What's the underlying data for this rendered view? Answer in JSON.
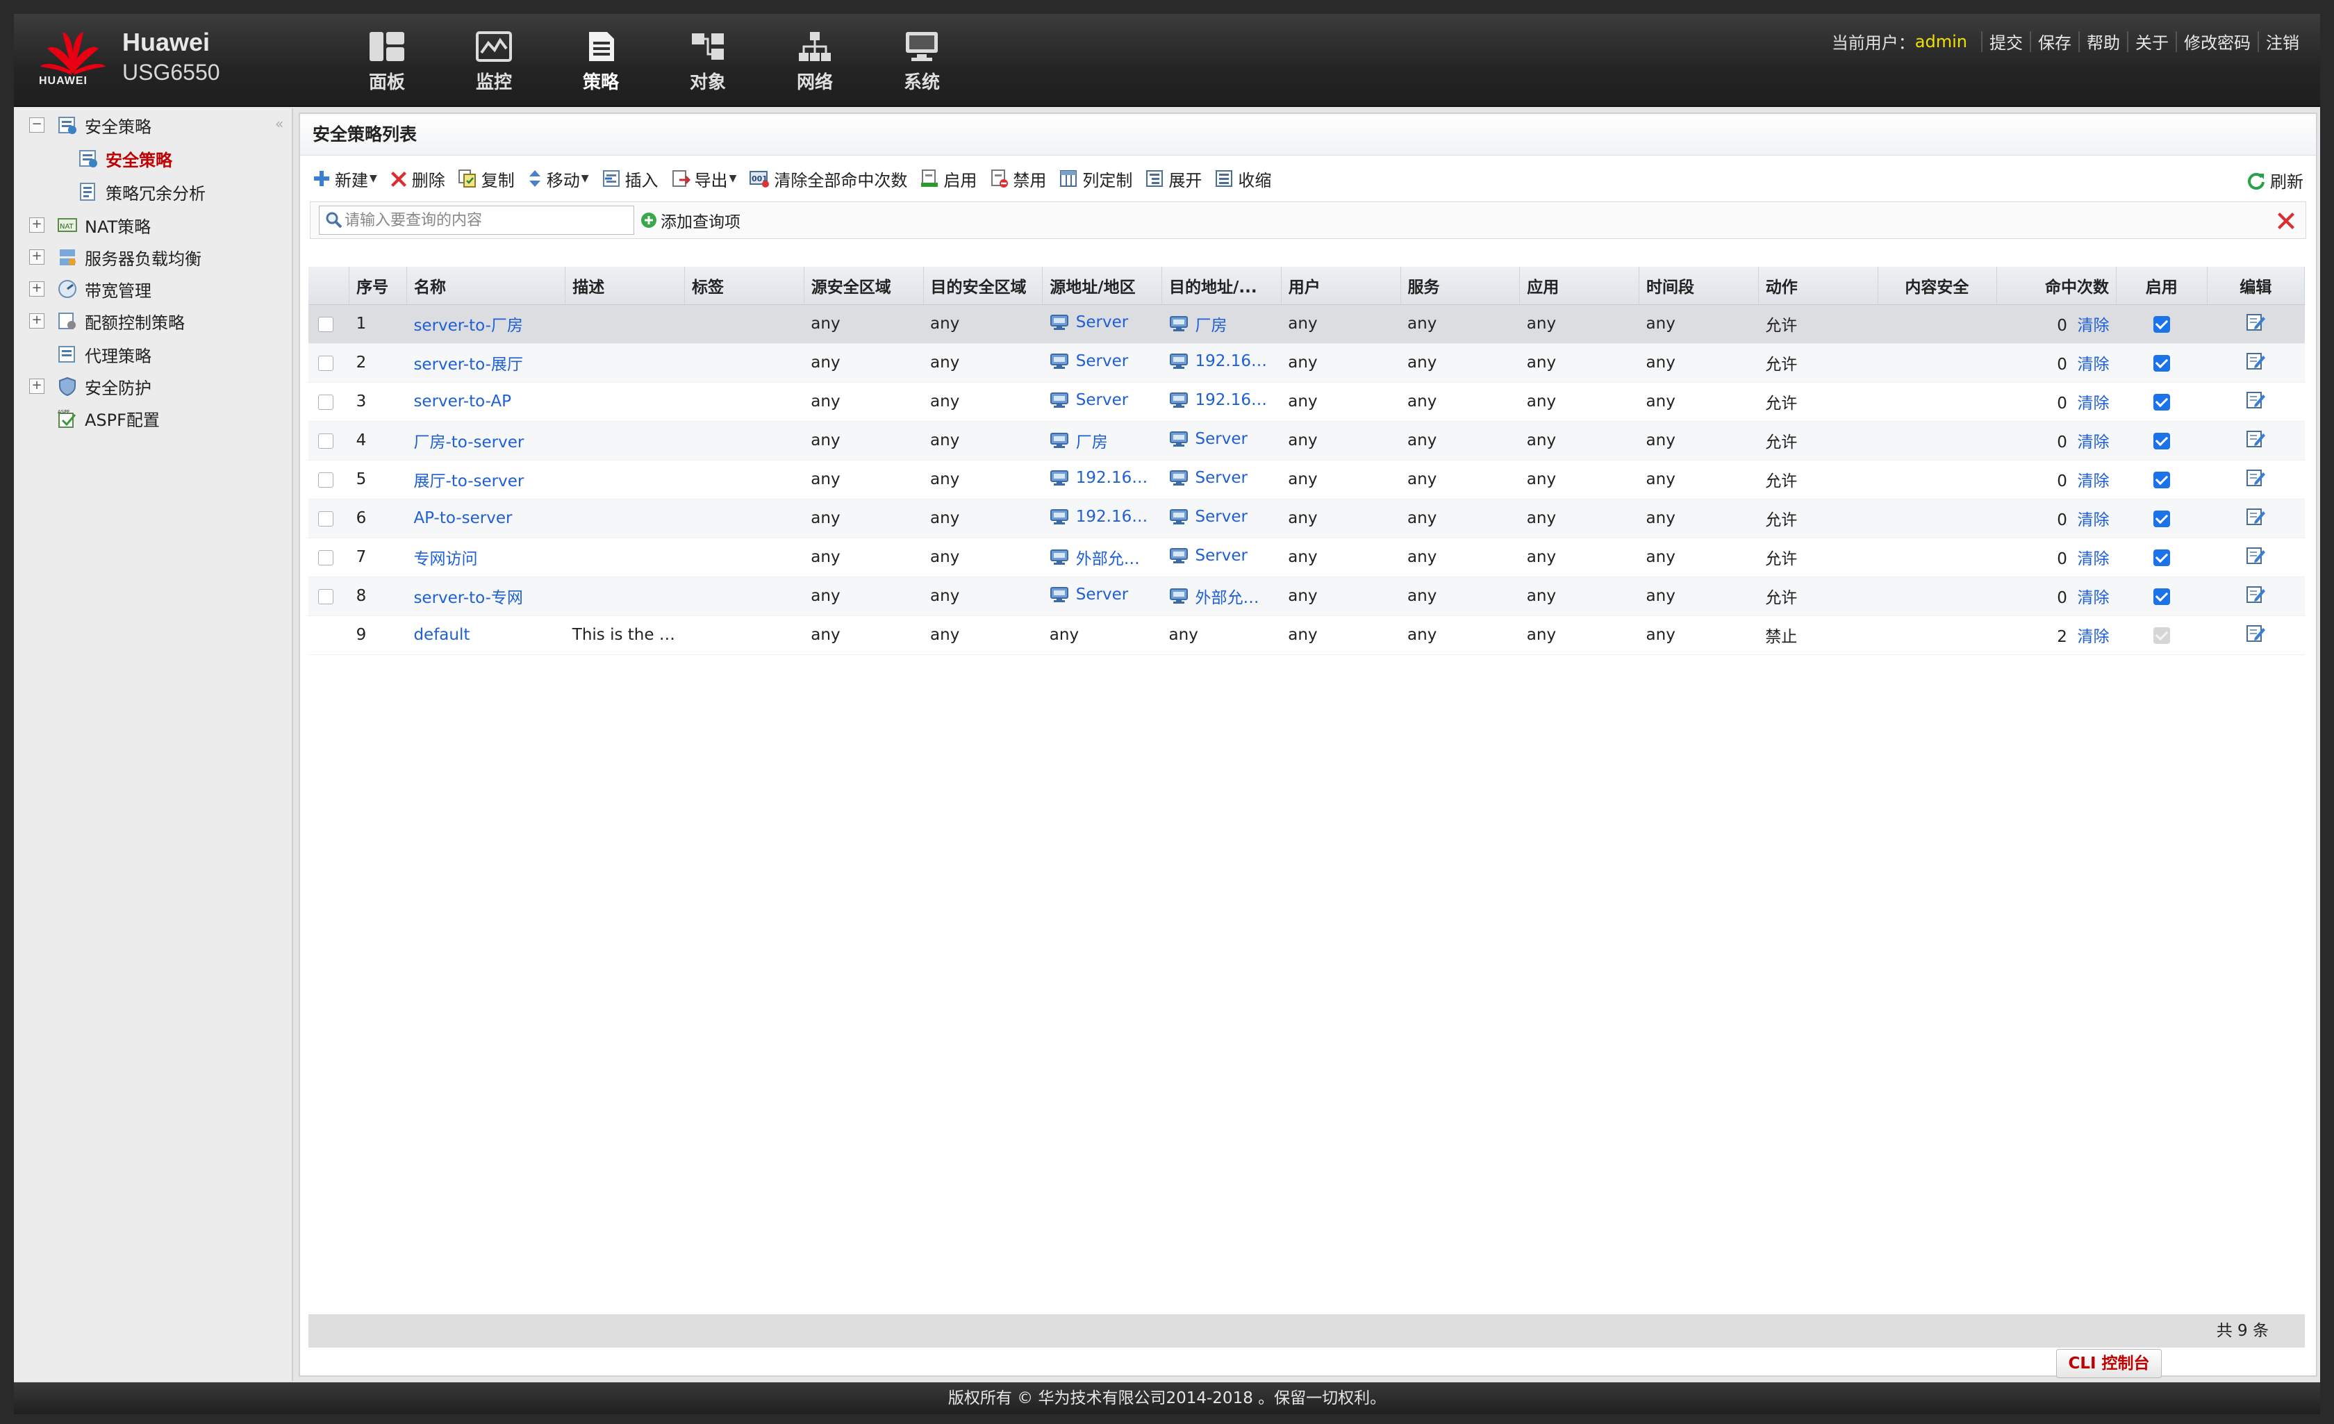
{
  "brand": {
    "logo_text": "HUAWEI",
    "name": "Huawei",
    "model": "USG6550"
  },
  "nav": [
    {
      "label": "面板",
      "icon": "dashboard-icon"
    },
    {
      "label": "监控",
      "icon": "monitor-icon"
    },
    {
      "label": "策略",
      "icon": "policy-icon"
    },
    {
      "label": "对象",
      "icon": "object-icon"
    },
    {
      "label": "网络",
      "icon": "network-icon"
    },
    {
      "label": "系统",
      "icon": "system-icon"
    }
  ],
  "userbar": {
    "user_label": "当前用户：",
    "user_name": "admin",
    "links": [
      "提交",
      "保存",
      "帮助",
      "关于",
      "修改密码",
      "注销"
    ]
  },
  "sidebar": {
    "items": [
      {
        "label": "安全策略",
        "expander": "−",
        "level": 0,
        "icon": "security-policy-icon"
      },
      {
        "label": "安全策略",
        "level": 1,
        "selected": true,
        "icon": "security-policy-icon"
      },
      {
        "label": "策略冗余分析",
        "level": 1,
        "icon": "analysis-icon"
      },
      {
        "label": "NAT策略",
        "expander": "+",
        "level": 0,
        "icon": "nat-icon"
      },
      {
        "label": "服务器负载均衡",
        "expander": "+",
        "level": 0,
        "icon": "load-balance-icon"
      },
      {
        "label": "带宽管理",
        "expander": "+",
        "level": 0,
        "icon": "bandwidth-icon"
      },
      {
        "label": "配额控制策略",
        "expander": "+",
        "level": 0,
        "icon": "quota-icon"
      },
      {
        "label": "代理策略",
        "level": 0,
        "icon": "proxy-icon"
      },
      {
        "label": "安全防护",
        "expander": "+",
        "level": 0,
        "icon": "shield-icon"
      },
      {
        "label": "ASPF配置",
        "level": 0,
        "icon": "aspf-icon"
      }
    ]
  },
  "panel": {
    "title": "安全策略列表"
  },
  "toolbar": {
    "new": "新建",
    "delete": "删除",
    "copy": "复制",
    "move": "移动",
    "insert": "插入",
    "export": "导出",
    "clear_hits": "清除全部命中次数",
    "enable": "启用",
    "disable": "禁用",
    "customize_columns": "列定制",
    "expand": "展开",
    "collapse": "收缩",
    "refresh": "刷新"
  },
  "query": {
    "placeholder": "请输入要查询的内容",
    "add_label": "添加查询项"
  },
  "table": {
    "headers": [
      "序号",
      "名称",
      "描述",
      "标签",
      "源安全区域",
      "目的安全区域",
      "源地址/地区",
      "目的地址/...",
      "用户",
      "服务",
      "应用",
      "时间段",
      "动作",
      "内容安全",
      "命中次数",
      "启用",
      "编辑"
    ],
    "clear_label": "清除",
    "rows": [
      {
        "no": "1",
        "name": "server-to-厂房",
        "desc": "",
        "src_zone": "any",
        "dst_zone": "any",
        "src_addr": "Server",
        "src_is_obj": true,
        "dst_addr": "厂房",
        "dst_is_obj": true,
        "user": "any",
        "service": "any",
        "app": "any",
        "time": "any",
        "action": "允许",
        "hits": "0",
        "enabled": true
      },
      {
        "no": "2",
        "name": "server-to-展厅",
        "desc": "",
        "src_zone": "any",
        "dst_zone": "any",
        "src_addr": "Server",
        "src_is_obj": true,
        "dst_addr": "192.16…",
        "dst_is_obj": true,
        "user": "any",
        "service": "any",
        "app": "any",
        "time": "any",
        "action": "允许",
        "hits": "0",
        "enabled": true
      },
      {
        "no": "3",
        "name": "server-to-AP",
        "desc": "",
        "src_zone": "any",
        "dst_zone": "any",
        "src_addr": "Server",
        "src_is_obj": true,
        "dst_addr": "192.16…",
        "dst_is_obj": true,
        "user": "any",
        "service": "any",
        "app": "any",
        "time": "any",
        "action": "允许",
        "hits": "0",
        "enabled": true
      },
      {
        "no": "4",
        "name": "厂房-to-server",
        "desc": "",
        "src_zone": "any",
        "dst_zone": "any",
        "src_addr": "厂房",
        "src_is_obj": true,
        "dst_addr": "Server",
        "dst_is_obj": true,
        "user": "any",
        "service": "any",
        "app": "any",
        "time": "any",
        "action": "允许",
        "hits": "0",
        "enabled": true
      },
      {
        "no": "5",
        "name": "展厅-to-server",
        "desc": "",
        "src_zone": "any",
        "dst_zone": "any",
        "src_addr": "192.16…",
        "src_is_obj": true,
        "dst_addr": "Server",
        "dst_is_obj": true,
        "user": "any",
        "service": "any",
        "app": "any",
        "time": "any",
        "action": "允许",
        "hits": "0",
        "enabled": true
      },
      {
        "no": "6",
        "name": "AP-to-server",
        "desc": "",
        "src_zone": "any",
        "dst_zone": "any",
        "src_addr": "192.16…",
        "src_is_obj": true,
        "dst_addr": "Server",
        "dst_is_obj": true,
        "user": "any",
        "service": "any",
        "app": "any",
        "time": "any",
        "action": "允许",
        "hits": "0",
        "enabled": true
      },
      {
        "no": "7",
        "name": "专网访问",
        "desc": "",
        "src_zone": "any",
        "dst_zone": "any",
        "src_addr": "外部允…",
        "src_is_obj": true,
        "dst_addr": "Server",
        "dst_is_obj": true,
        "user": "any",
        "service": "any",
        "app": "any",
        "time": "any",
        "action": "允许",
        "hits": "0",
        "enabled": true
      },
      {
        "no": "8",
        "name": "server-to-专网",
        "desc": "",
        "src_zone": "any",
        "dst_zone": "any",
        "src_addr": "Server",
        "src_is_obj": true,
        "dst_addr": "外部允…",
        "dst_is_obj": true,
        "user": "any",
        "service": "any",
        "app": "any",
        "time": "any",
        "action": "允许",
        "hits": "0",
        "enabled": true
      },
      {
        "no": "9",
        "name": "default",
        "desc": "This is the …",
        "src_zone": "any",
        "dst_zone": "any",
        "src_addr": "any",
        "src_is_obj": false,
        "dst_addr": "any",
        "dst_is_obj": false,
        "user": "any",
        "service": "any",
        "app": "any",
        "time": "any",
        "action": "禁止",
        "hits": "2",
        "enabled": true,
        "is_default": true
      }
    ],
    "total": "共 9 条"
  },
  "cli_button": "CLI 控制台",
  "copyright": "版权所有 © 华为技术有限公司2014-2018 。保留一切权利。",
  "colors": {
    "allow": "#1aa01a",
    "deny": "#cc0000",
    "link": "#1f5fd6",
    "selected": "#c00000",
    "accent_user": "#f0e000"
  }
}
